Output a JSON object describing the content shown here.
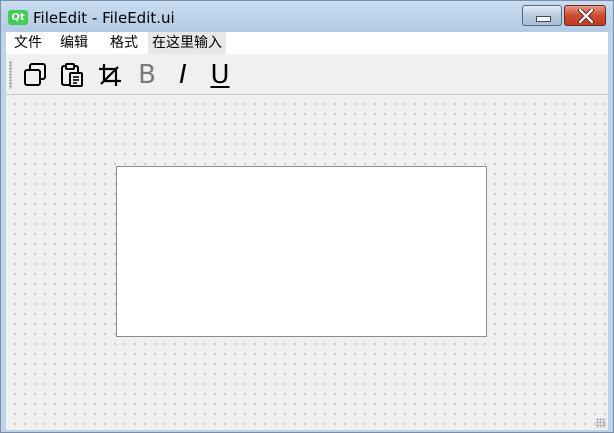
{
  "window": {
    "app_icon_text": "Qt",
    "title": "FileEdit - FileEdit.ui",
    "colors": {
      "qt_green": "#41cd52",
      "close_red": "#c7422a",
      "titlebar": "#bcd3ea"
    }
  },
  "menubar": {
    "items": [
      {
        "label": "文件"
      },
      {
        "label": "编辑"
      },
      {
        "label": "格式"
      },
      {
        "label": "在这里输入"
      }
    ]
  },
  "toolbar": {
    "tools": [
      {
        "icon": "copy-icon"
      },
      {
        "icon": "paste-icon"
      },
      {
        "icon": "cut-icon"
      },
      {
        "icon": "bold-icon",
        "letter": "B",
        "state": "disabled"
      },
      {
        "icon": "italic-icon",
        "letter": "I"
      },
      {
        "icon": "underline-icon",
        "letter": "U"
      }
    ]
  },
  "editor": {
    "text": ""
  }
}
